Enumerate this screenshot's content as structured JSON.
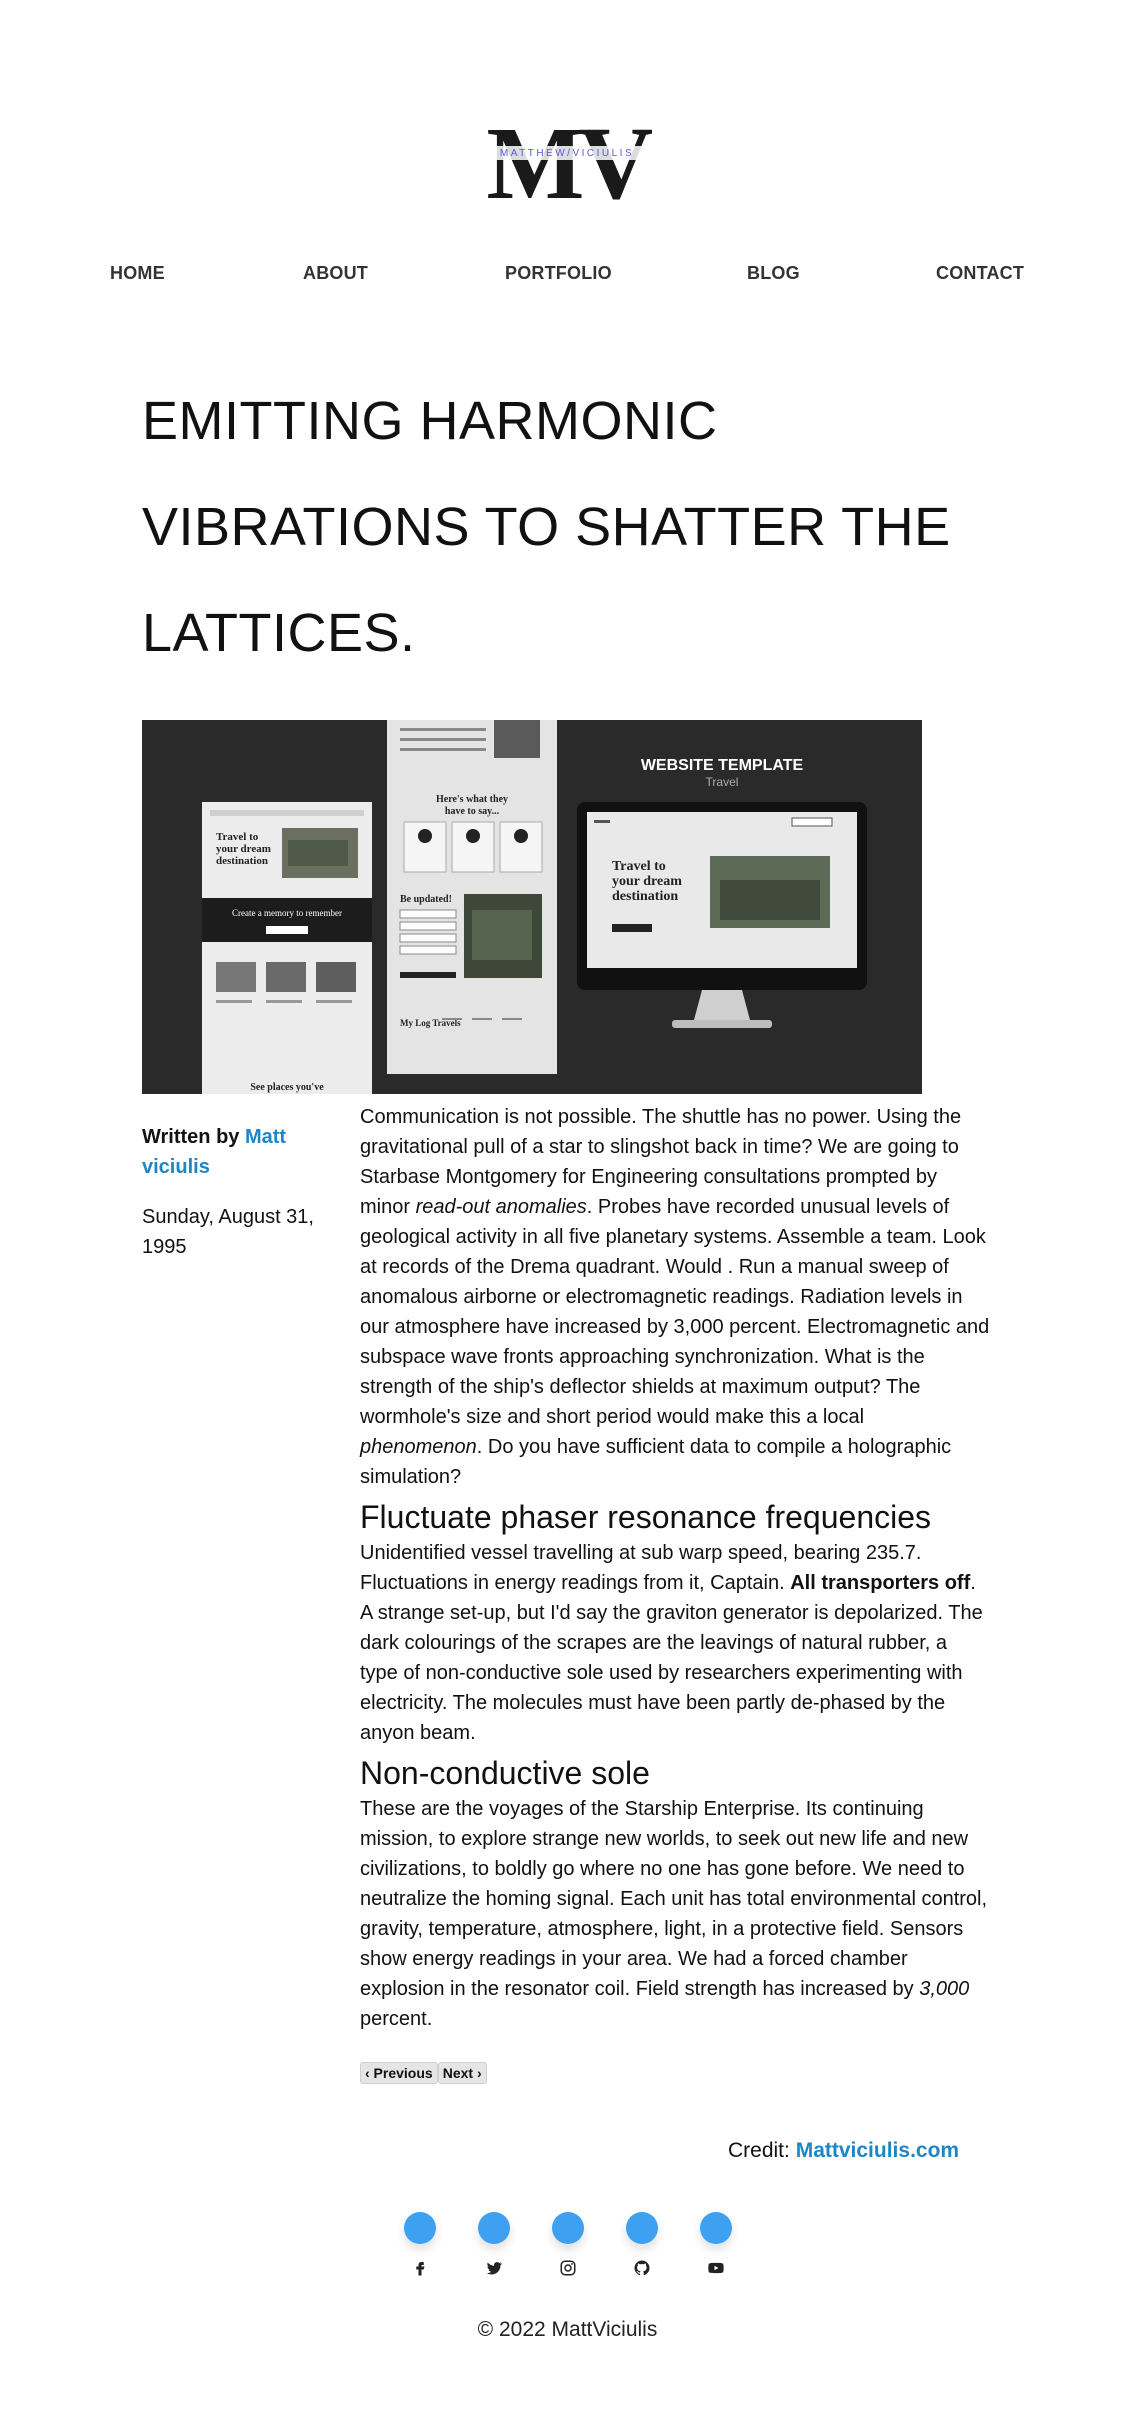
{
  "logo": {
    "letters": "MV",
    "tagline": "MATTHEW/VICIULIS"
  },
  "nav": {
    "items": [
      {
        "label": "HOME"
      },
      {
        "label": "ABOUT"
      },
      {
        "label": "PORTFOLIO"
      },
      {
        "label": "BLOG"
      },
      {
        "label": "CONTACT"
      }
    ]
  },
  "post": {
    "title": "EMITTING HARMONIC VIBRATIONS TO SHATTER THE LATTICES.",
    "hero": {
      "heading": "WEBSITE TEMPLATE",
      "subheading": "Travel",
      "panel_left_title": "Travel to your dream destination",
      "panel_left_mid": "Create a memory to remember",
      "panel_left_bottom": "See places you've",
      "panel_mid_title": "Here's what they have to say...",
      "panel_mid_form": "Be updated!",
      "panel_mid_footer": "My Log Travels",
      "monitor_title": "Travel to your dream destination",
      "colors": {
        "background": "#2a2a2a",
        "panel": "#e8e8e8",
        "accent": "#222222"
      }
    },
    "byline": {
      "prefix": "Written by",
      "author": "Matt viciulis",
      "date": "Sunday, August 31, 1995"
    },
    "body": {
      "p1_a": "Communication is not possible. The shuttle has no power. Using the gravitational pull of a star to slingshot back in time? We are going to Starbase Montgomery for Engineering consultations prompted by minor ",
      "p1_em1": "read-out anomalies",
      "p1_b": ". Probes have recorded unusual levels of geological activity in all five planetary systems. Assemble a team. Look at records of the Drema quadrant. Would . Run a manual sweep of anomalous airborne or electromagnetic readings. Radiation levels in our atmosphere have increased by 3,000 percent. Electromagnetic and subspace wave fronts approaching synchronization. What is the strength of the ship's deflector shields at maximum output? The wormhole's size and short period would make this a local ",
      "p1_em2": "phenomenon",
      "p1_c": ". Do you have sufficient data to compile a holographic simulation?",
      "h2_1": "Fluctuate phaser resonance frequencies",
      "p2_a": "Unidentified vessel travelling at sub warp speed, bearing 235.7. Fluctuations in energy readings from it, Captain. ",
      "p2_strong": "All transporters off",
      "p2_b": ". A strange set-up, but I'd say the graviton generator is depolarized. The dark colourings of the scrapes are the leavings of natural rubber, a type of non-conductive sole used by researchers experimenting with electricity. The molecules must have been partly de-phased by the anyon beam.",
      "h2_2": "Non-conductive sole",
      "p3_a": "These are the voyages of the Starship Enterprise. Its continuing mission, to explore strange new worlds, to seek out new life and new civilizations, to boldly go where no one has gone before. We need to neutralize the homing signal. Each unit has total environmental control, gravity, temperature, atmosphere, light, in a protective field. Sensors show energy readings in your area. We had a forced chamber explosion in the resonator coil. Field strength has increased by ",
      "p3_em": "3,000",
      "p3_b": " percent."
    },
    "pager": {
      "prev": "‹ Previous",
      "next": "Next ›"
    }
  },
  "credit": {
    "label": "Credit:",
    "link": "Mattviciulis.com"
  },
  "social": [
    {
      "icon": "facebook-icon"
    },
    {
      "icon": "twitter-icon"
    },
    {
      "icon": "instagram-icon"
    },
    {
      "icon": "github-icon"
    },
    {
      "icon": "youtube-icon"
    }
  ],
  "footer": {
    "copyright": "© 2022 MattViciulis"
  },
  "colors": {
    "link": "#1c86c7",
    "social_dot": "#3ea0f0",
    "text": "#111111"
  }
}
